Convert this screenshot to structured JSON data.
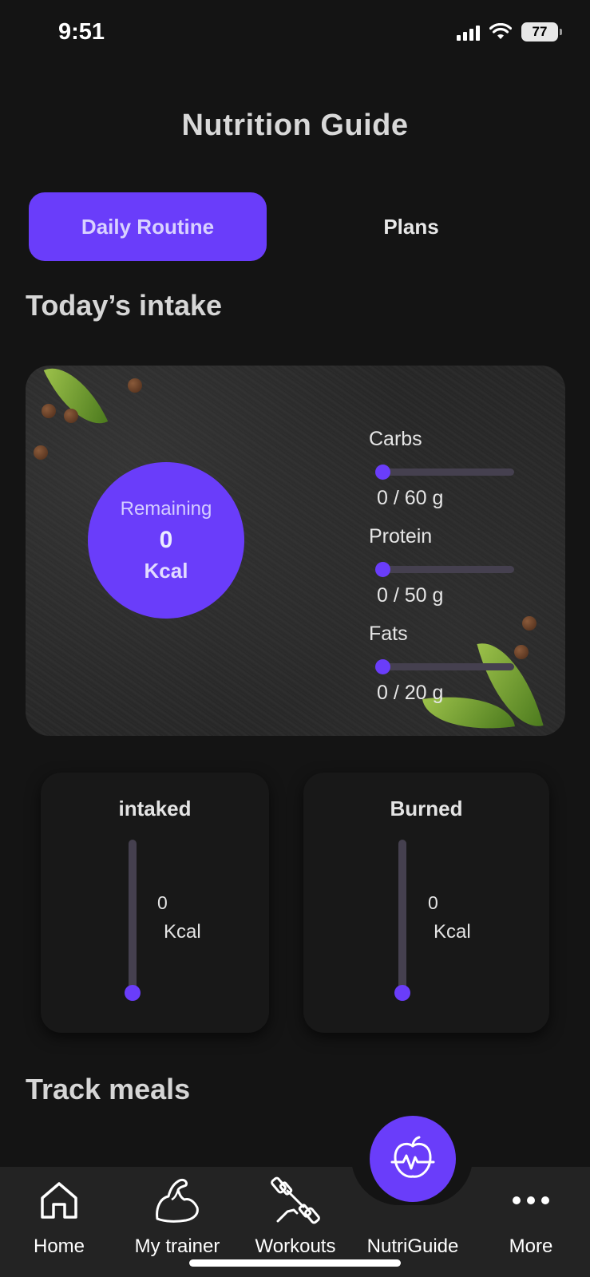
{
  "status_bar": {
    "time": "9:51",
    "battery": "77"
  },
  "header": {
    "title": "Nutrition Guide"
  },
  "tabs": [
    {
      "label": "Daily Routine",
      "active": true
    },
    {
      "label": "Plans",
      "active": false
    }
  ],
  "intake": {
    "section_title": "Today’s intake",
    "remaining": {
      "label": "Remaining",
      "value": "0",
      "unit": "Kcal"
    },
    "macros": [
      {
        "name": "Carbs",
        "value": "0 / 60 g",
        "progress": 0
      },
      {
        "name": "Protein",
        "value": "0 / 50 g",
        "progress": 0
      },
      {
        "name": "Fats",
        "value": "0 / 20 g",
        "progress": 0
      }
    ]
  },
  "stats": {
    "intaked": {
      "title": "intaked",
      "value": "0",
      "unit": "Kcal",
      "progress": 0
    },
    "burned": {
      "title": "Burned",
      "value": "0",
      "unit": "Kcal",
      "progress": 0
    }
  },
  "meals": {
    "section_title": "Track meals"
  },
  "nav": {
    "items": [
      {
        "label": "Home",
        "icon": "home-icon"
      },
      {
        "label": "My trainer",
        "icon": "bicep-icon"
      },
      {
        "label": "Workouts",
        "icon": "dumbbell-icon"
      },
      {
        "label": "NutriGuide",
        "icon": "apple-heartbeat-icon",
        "active": true
      },
      {
        "label": "More",
        "icon": "more-dots-icon"
      }
    ]
  },
  "colors": {
    "accent": "#6a3dfa",
    "background": "#141414",
    "card": "#181818",
    "track": "#45404f"
  }
}
